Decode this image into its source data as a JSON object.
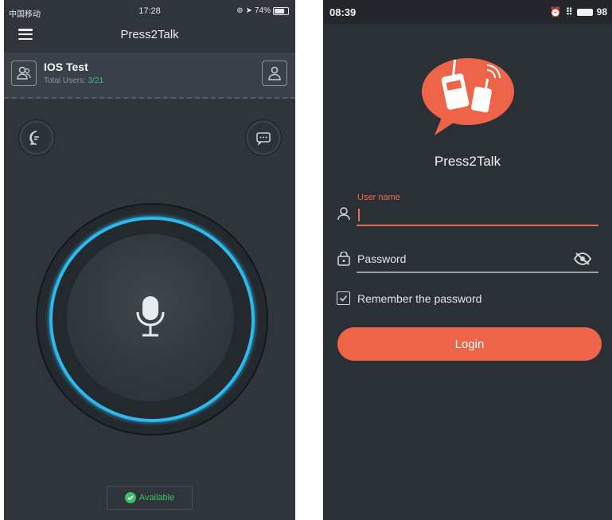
{
  "left_screen": {
    "status_bar": {
      "carrier": "中国移动",
      "time": "17:28",
      "battery": "74%"
    },
    "title": "Press2Talk",
    "group": {
      "name": "IOS Test",
      "users_label": "Total Users:",
      "users_count": "3/21"
    },
    "ptt_status": "Available",
    "colors": {
      "ring": "#2db8ef",
      "available": "#3fbf6a"
    }
  },
  "right_screen": {
    "status_bar": {
      "time": "08:39",
      "battery": "98"
    },
    "brand": "Press2Talk",
    "username": {
      "label": "User name",
      "value": ""
    },
    "password": {
      "placeholder": "Password"
    },
    "remember": {
      "label": "Remember the password",
      "checked": true
    },
    "login_label": "Login",
    "colors": {
      "accent": "#ee6448"
    }
  }
}
